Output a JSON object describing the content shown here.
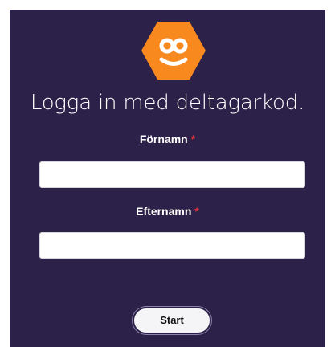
{
  "logo": {
    "icon": "kahoot-style-hexagon-logo-icon",
    "color": "#f7891f"
  },
  "title": "Logga in med deltagarkod.",
  "form": {
    "first_name": {
      "label": "Förnamn",
      "required_marker": "*",
      "value": "",
      "placeholder": ""
    },
    "last_name": {
      "label": "Efternamn",
      "required_marker": "*",
      "value": "",
      "placeholder": ""
    },
    "submit_label": "Start"
  },
  "colors": {
    "background": "#2c2148",
    "accent": "#f7891f",
    "required": "#e0323c",
    "button_bg": "#f5f5f7"
  }
}
